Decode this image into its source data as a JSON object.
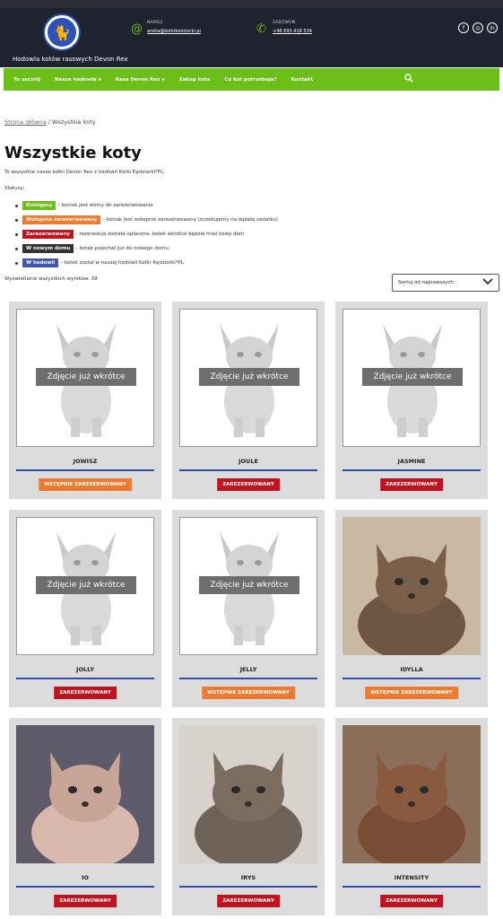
{
  "header": {
    "brand": "Hodowla kotów rasowych Devon Rex",
    "email_label": "NAPISZ",
    "email": "aneta@kotkikedziorki.pl",
    "phone_label": "ZADZWOŃ",
    "phone": "+48 693 418 534",
    "socials": [
      "facebook-icon",
      "instagram-icon",
      "linkedin-icon"
    ]
  },
  "nav": {
    "items": [
      "Tu zacznij",
      "Nasza hodowla",
      "Rasa Devon Rex",
      "Zakup kota",
      "Co kot potrzebuje?",
      "Kontakt"
    ]
  },
  "breadcrumb": {
    "home": "Strona główna",
    "separator": " / ",
    "current": "Wszystkie koty"
  },
  "page": {
    "title": "Wszystkie koty",
    "intro": "To wszystkie nasze kotki Devon Rex z hodowli Kotki Kędziorki*PL.",
    "statuses_label": "Statusy:"
  },
  "statuses": [
    {
      "label": "Dostępny",
      "desc": " – kociak jest wolny do zarezerwowania",
      "color": "#6cbf19"
    },
    {
      "label": "Wstępnie zarezerwowany",
      "desc": " – kociak jest wstępnie zarezerwowany (oczekujemy na wpłatę zadatku)",
      "color": "#ee7b30"
    },
    {
      "label": "Zarezerwowany",
      "desc": " – rezerwacja została opłacona, kotek wkrótce będzie miał nowy dom",
      "color": "#c1121f"
    },
    {
      "label": "W nowym domu",
      "desc": " – kotek pojechał już do nowego domu",
      "color": "#333333"
    },
    {
      "label": "W hodowli",
      "desc": " – kotek został w naszej hodowli Kotki Kędziorki*PL",
      "color": "#3f57b0"
    }
  ],
  "results": "Wyświetlanie wszystkich wyników: 39",
  "sort": {
    "selected": "Sortuj od najnowszych"
  },
  "placeholder_text": "Zdjęcie już wkrótce",
  "products": [
    {
      "name": "JOWISZ",
      "status": "WSTĘPNIE ZAREZERWOWANY",
      "color": "#ee7b30",
      "image": "placeholder"
    },
    {
      "name": "JOULE",
      "status": "ZAREZERWOWANY",
      "color": "#c1121f",
      "image": "placeholder"
    },
    {
      "name": "JASMINE",
      "status": "ZAREZERWOWANY",
      "color": "#c1121f",
      "image": "placeholder"
    },
    {
      "name": "JOLLY",
      "status": "ZAREZERWOWANY",
      "color": "#c1121f",
      "image": "placeholder"
    },
    {
      "name": "JELLY",
      "status": "WSTĘPNIE ZAREZERWOWANY",
      "color": "#ee7b30",
      "image": "placeholder"
    },
    {
      "name": "IDYLLA",
      "status": "WSTĘPNIE ZAREZERWOWANY",
      "color": "#ee7b30",
      "image": "photo"
    },
    {
      "name": "IO",
      "status": "ZAREZERWOWANY",
      "color": "#c1121f",
      "image": "photo"
    },
    {
      "name": "IRYS",
      "status": "ZAREZERWOWANY",
      "color": "#c1121f",
      "image": "photo"
    },
    {
      "name": "INTENSITY",
      "status": "ZAREZERWOWANY",
      "color": "#c1121f",
      "image": "photo"
    }
  ]
}
